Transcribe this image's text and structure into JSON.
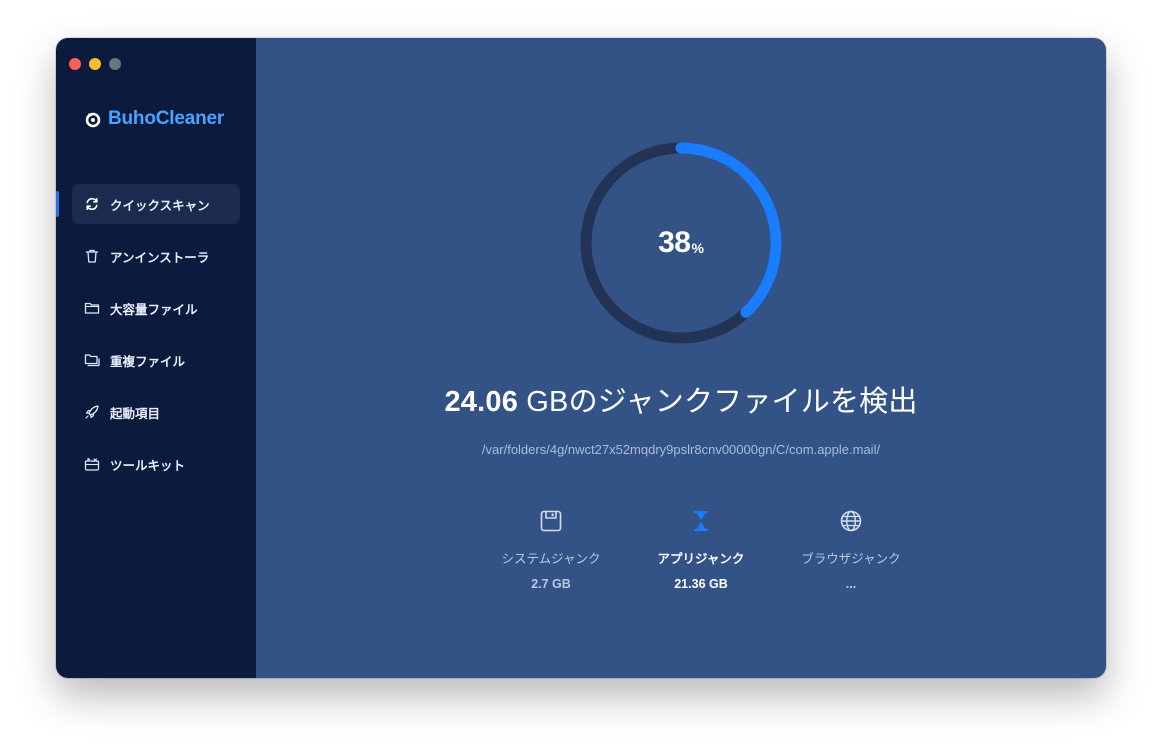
{
  "window": {
    "traffic_lights": {
      "close_color": "#ff5f57",
      "minimize_color": "#febc2e",
      "zoom_color": "#6b7280"
    }
  },
  "app": {
    "name": "BuhoCleaner",
    "brand_color": "#4aa3ff"
  },
  "sidebar": {
    "items": [
      {
        "label": "クイックスキャン",
        "icon": "refresh-icon",
        "active": true
      },
      {
        "label": "アンインストーラ",
        "icon": "trash-icon",
        "active": false
      },
      {
        "label": "大容量ファイル",
        "icon": "folder-icon",
        "active": false
      },
      {
        "label": "重複ファイル",
        "icon": "duplicate-folder-icon",
        "active": false
      },
      {
        "label": "起動項目",
        "icon": "rocket-icon",
        "active": false
      },
      {
        "label": "ツールキット",
        "icon": "toolbox-icon",
        "active": false
      }
    ]
  },
  "scan": {
    "progress_value": "38",
    "progress_unit": "%",
    "progress_fraction": 0.38,
    "accent_color": "#1a7cff",
    "headline_amount": "24.06",
    "headline_rest": " GBのジャンクファイルを検出",
    "current_path": "/var/folders/4g/nwct27x52mqdry9pslr8cnv00000gn/C/com.apple.mail/"
  },
  "categories": [
    {
      "label": "システムジャンク",
      "value": "2.7 GB",
      "icon": "save-icon",
      "active": false
    },
    {
      "label": "アプリジャンク",
      "value": "21.36 GB",
      "icon": "hourglass-icon",
      "active": true
    },
    {
      "label": "ブラウザジャンク",
      "value": "...",
      "icon": "globe-icon",
      "active": false
    }
  ]
}
